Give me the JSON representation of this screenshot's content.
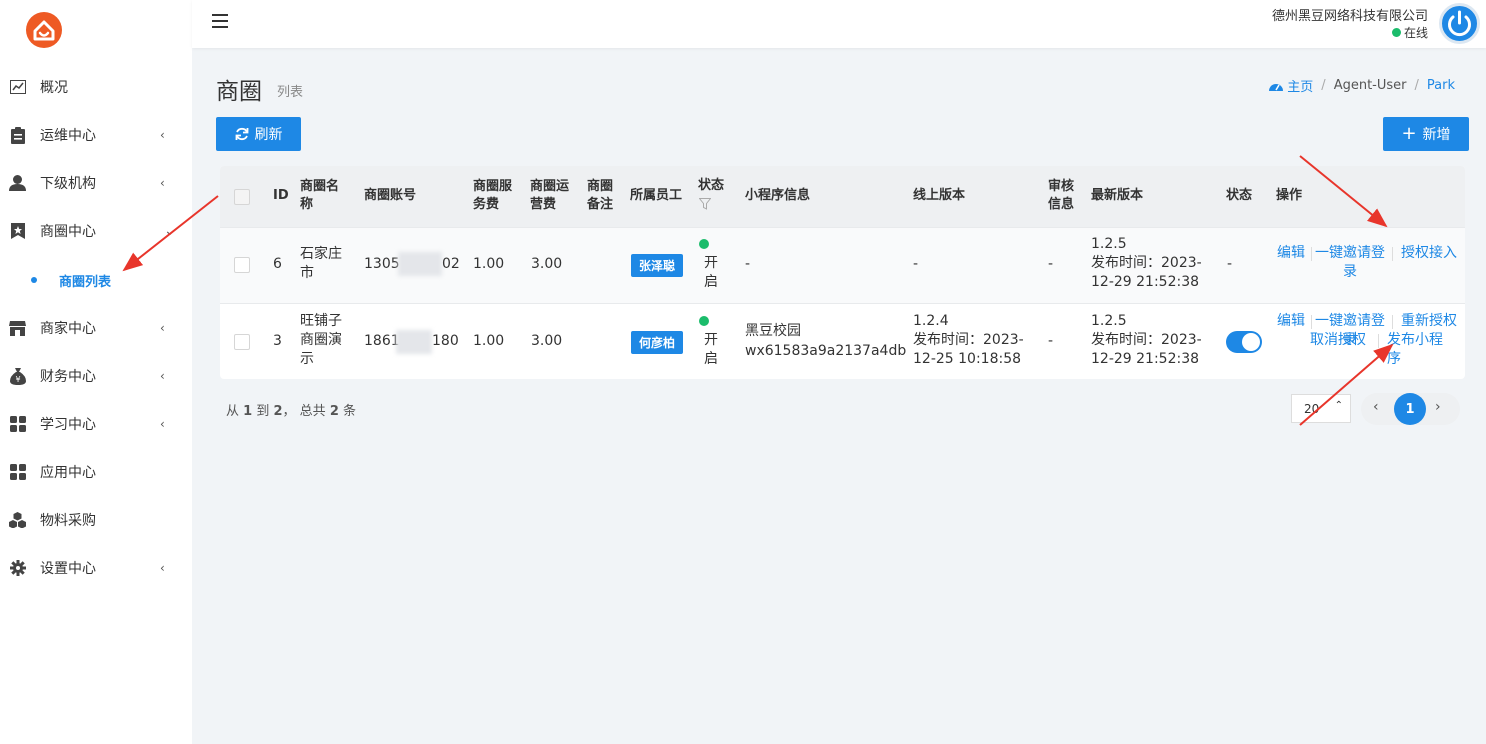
{
  "sidebar": {
    "items": [
      {
        "label": "概况",
        "icon": "chart-icon"
      },
      {
        "label": "运维中心",
        "icon": "clipboard-icon",
        "arrow": "‹"
      },
      {
        "label": "下级机构",
        "icon": "user-icon",
        "arrow": "‹"
      },
      {
        "label": "商圈中心",
        "icon": "bookmark-icon",
        "arrow": "⌄"
      },
      {
        "label": "商家中心",
        "icon": "store-icon",
        "arrow": "‹"
      },
      {
        "label": "财务中心",
        "icon": "money-bag-icon",
        "arrow": "‹"
      },
      {
        "label": "学习中心",
        "icon": "grid-icon",
        "arrow": "‹"
      },
      {
        "label": "应用中心",
        "icon": "apps-icon"
      },
      {
        "label": "物料采购",
        "icon": "cubes-icon"
      },
      {
        "label": "设置中心",
        "icon": "gear-icon",
        "arrow": "‹"
      }
    ],
    "sub_item": "商圈列表"
  },
  "header": {
    "company": "德州黑豆网络科技有限公司",
    "status": "在线"
  },
  "page": {
    "title": "商圈",
    "subtitle": "列表",
    "breadcrumb": [
      "主页",
      "Agent-User",
      "Park"
    ],
    "refresh_label": "刷新",
    "add_label": "新增"
  },
  "table": {
    "headers": {
      "id": "ID",
      "name": "商圈名称",
      "account": "商圈账号",
      "service_fee": "商圈服务费",
      "ops_fee": "商圈运营费",
      "remark": "商圈备注",
      "staff": "所属员工",
      "status": "状态",
      "mini": "小程序信息",
      "online_ver": "线上版本",
      "audit": "审核信息",
      "latest_ver": "最新版本",
      "status2": "状态",
      "ops": "操作"
    },
    "rows": [
      {
        "id": "6",
        "name": "石家庄市",
        "account_a": "1305",
        "account_b": "02",
        "service_fee": "1.00",
        "ops_fee": "3.00",
        "remark": "",
        "staff": "张泽聪",
        "status": "开启",
        "mini": "-",
        "online_ver": "-",
        "audit": "-",
        "latest_ver": "1.2.5",
        "latest_time": "发布时间：2023-12-29 21:52:38",
        "status2": "-",
        "actions": [
          "编辑",
          "一键邀请登录",
          "授权接入"
        ]
      },
      {
        "id": "3",
        "name": "旺铺子商圈演示",
        "account_a": "1861",
        "account_b": "180",
        "service_fee": "1.00",
        "ops_fee": "3.00",
        "remark": "",
        "staff": "何彦柏",
        "status": "开启",
        "mini_name": "黑豆校园",
        "mini_id": "wx61583a9a2137a4db",
        "online_ver": "1.2.4",
        "online_time": "发布时间：2023-12-25 10:18:58",
        "audit": "-",
        "latest_ver": "1.2.5",
        "latest_time": "发布时间：2023-12-29 21:52:38",
        "status2": "on",
        "actions": [
          "编辑",
          "一键邀请登录",
          "重新授权",
          "取消授权",
          "发布小程序"
        ]
      }
    ]
  },
  "footer": {
    "summary_pre": "从",
    "from": "1",
    "summary_mid1": "到",
    "to": "2",
    "summary_mid2": "， 总共",
    "total": "2",
    "summary_post": "条",
    "page_size": "20",
    "current_page": "1"
  },
  "colors": {
    "accent": "#1e88e5",
    "logo": "#ee5a24",
    "online": "#1bbc6b",
    "annotation": "#e8352b"
  }
}
